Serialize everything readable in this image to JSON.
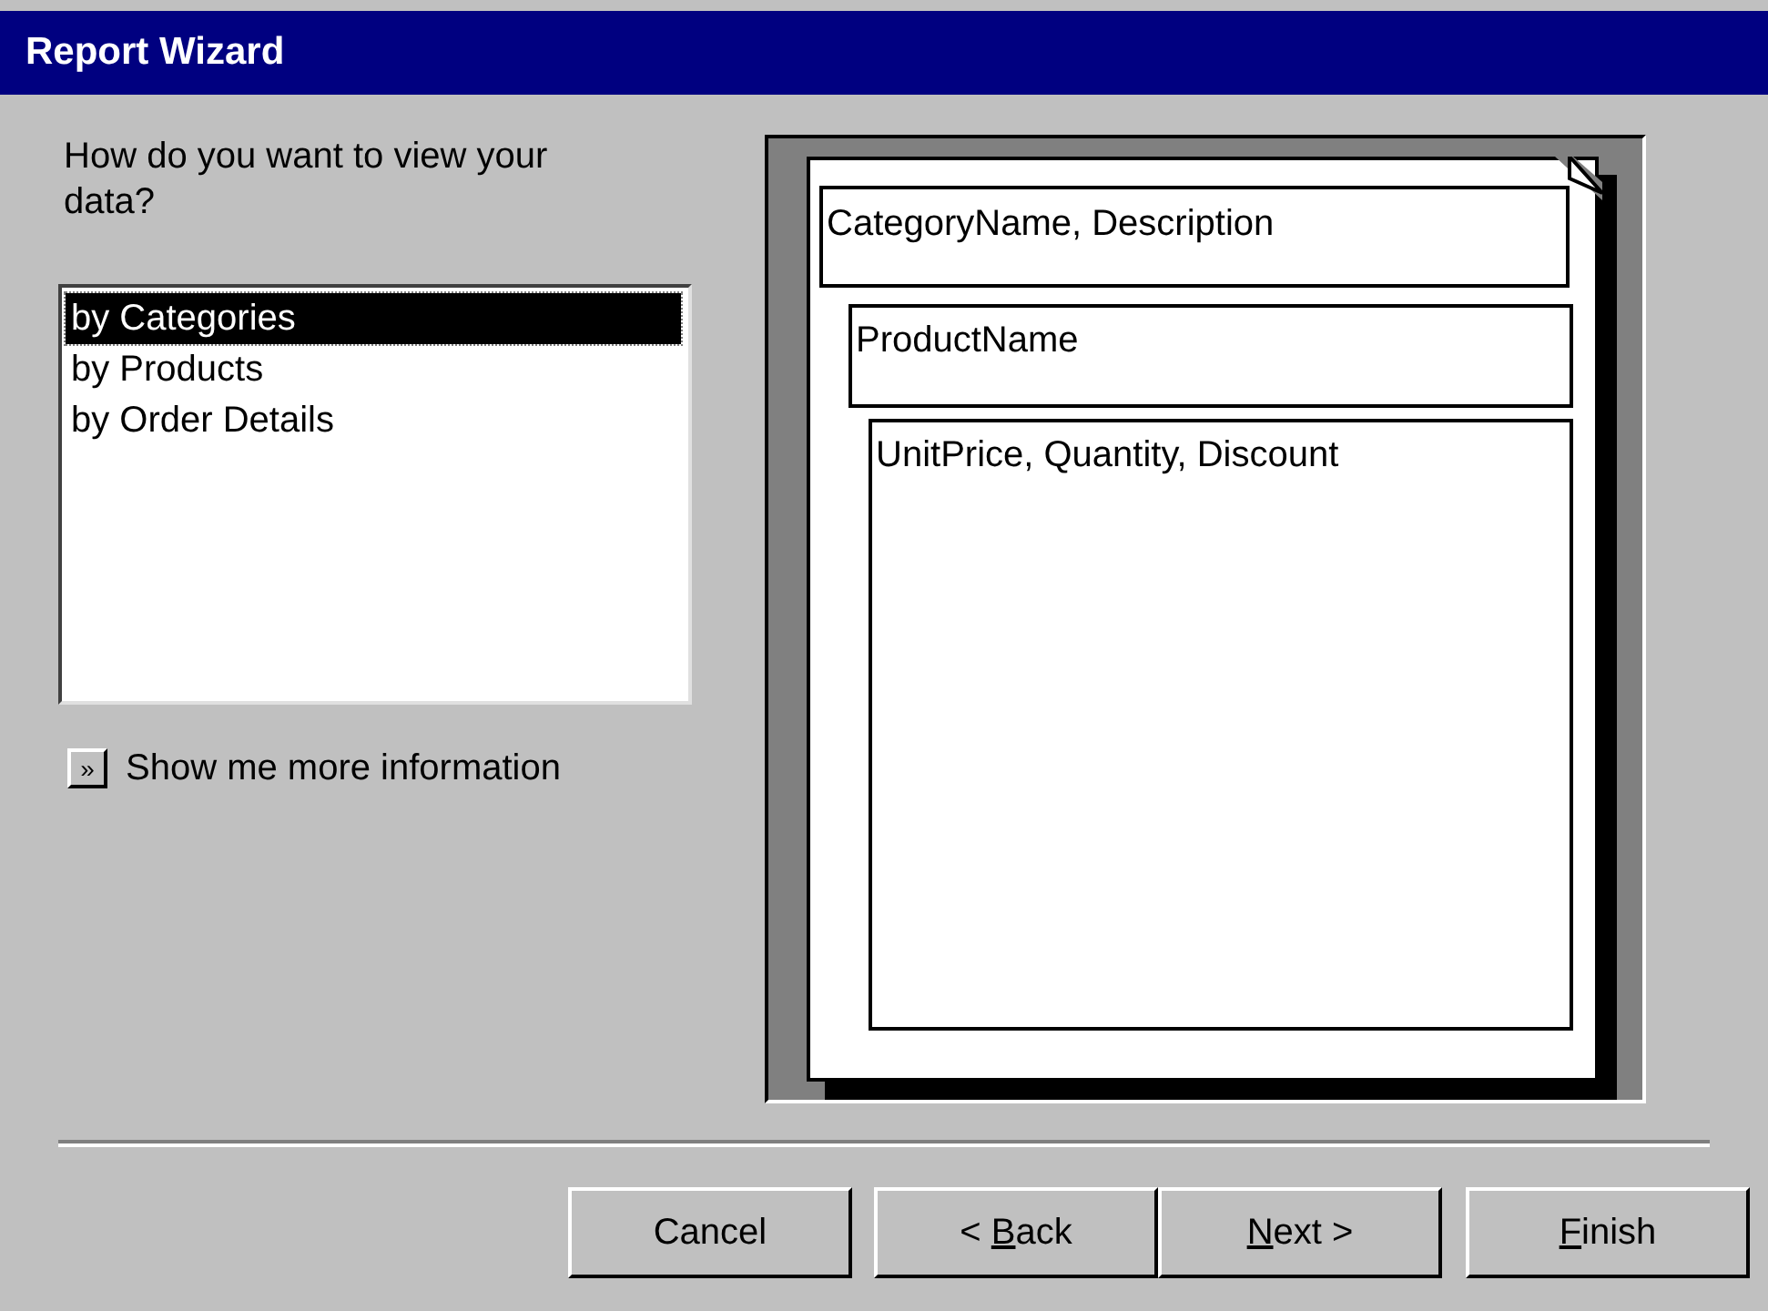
{
  "window": {
    "title": "Report Wizard"
  },
  "prompt": "How do you want to view your data?",
  "views": [
    {
      "label": "by Categories",
      "selected": true
    },
    {
      "label": "by Products",
      "selected": false
    },
    {
      "label": "by Order Details",
      "selected": false
    }
  ],
  "more_info": {
    "button": "»",
    "label": "Show me more information"
  },
  "preview": {
    "levels": [
      "CategoryName, Description",
      "ProductName",
      "UnitPrice, Quantity, Discount"
    ]
  },
  "buttons": [
    {
      "before": "Cancel"
    },
    {
      "before": "< ",
      "key": "B",
      "after": "ack"
    },
    {
      "key": "N",
      "after": "ext >"
    },
    {
      "key": "F",
      "after": "inish"
    }
  ]
}
